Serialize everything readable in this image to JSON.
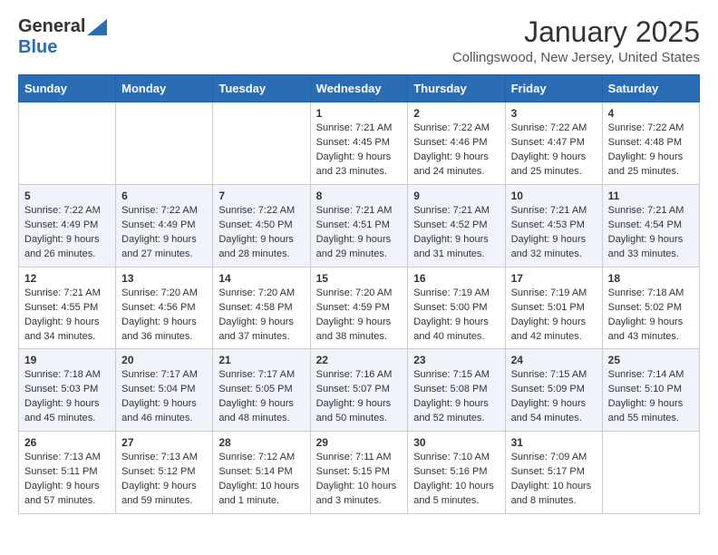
{
  "logo": {
    "general": "General",
    "blue": "Blue"
  },
  "header": {
    "month": "January 2025",
    "location": "Collingswood, New Jersey, United States"
  },
  "weekdays": [
    "Sunday",
    "Monday",
    "Tuesday",
    "Wednesday",
    "Thursday",
    "Friday",
    "Saturday"
  ],
  "weeks": [
    [
      {
        "day": "",
        "info": ""
      },
      {
        "day": "",
        "info": ""
      },
      {
        "day": "",
        "info": ""
      },
      {
        "day": "1",
        "info": "Sunrise: 7:21 AM\nSunset: 4:45 PM\nDaylight: 9 hours\nand 23 minutes."
      },
      {
        "day": "2",
        "info": "Sunrise: 7:22 AM\nSunset: 4:46 PM\nDaylight: 9 hours\nand 24 minutes."
      },
      {
        "day": "3",
        "info": "Sunrise: 7:22 AM\nSunset: 4:47 PM\nDaylight: 9 hours\nand 25 minutes."
      },
      {
        "day": "4",
        "info": "Sunrise: 7:22 AM\nSunset: 4:48 PM\nDaylight: 9 hours\nand 25 minutes."
      }
    ],
    [
      {
        "day": "5",
        "info": "Sunrise: 7:22 AM\nSunset: 4:49 PM\nDaylight: 9 hours\nand 26 minutes."
      },
      {
        "day": "6",
        "info": "Sunrise: 7:22 AM\nSunset: 4:49 PM\nDaylight: 9 hours\nand 27 minutes."
      },
      {
        "day": "7",
        "info": "Sunrise: 7:22 AM\nSunset: 4:50 PM\nDaylight: 9 hours\nand 28 minutes."
      },
      {
        "day": "8",
        "info": "Sunrise: 7:21 AM\nSunset: 4:51 PM\nDaylight: 9 hours\nand 29 minutes."
      },
      {
        "day": "9",
        "info": "Sunrise: 7:21 AM\nSunset: 4:52 PM\nDaylight: 9 hours\nand 31 minutes."
      },
      {
        "day": "10",
        "info": "Sunrise: 7:21 AM\nSunset: 4:53 PM\nDaylight: 9 hours\nand 32 minutes."
      },
      {
        "day": "11",
        "info": "Sunrise: 7:21 AM\nSunset: 4:54 PM\nDaylight: 9 hours\nand 33 minutes."
      }
    ],
    [
      {
        "day": "12",
        "info": "Sunrise: 7:21 AM\nSunset: 4:55 PM\nDaylight: 9 hours\nand 34 minutes."
      },
      {
        "day": "13",
        "info": "Sunrise: 7:20 AM\nSunset: 4:56 PM\nDaylight: 9 hours\nand 36 minutes."
      },
      {
        "day": "14",
        "info": "Sunrise: 7:20 AM\nSunset: 4:58 PM\nDaylight: 9 hours\nand 37 minutes."
      },
      {
        "day": "15",
        "info": "Sunrise: 7:20 AM\nSunset: 4:59 PM\nDaylight: 9 hours\nand 38 minutes."
      },
      {
        "day": "16",
        "info": "Sunrise: 7:19 AM\nSunset: 5:00 PM\nDaylight: 9 hours\nand 40 minutes."
      },
      {
        "day": "17",
        "info": "Sunrise: 7:19 AM\nSunset: 5:01 PM\nDaylight: 9 hours\nand 42 minutes."
      },
      {
        "day": "18",
        "info": "Sunrise: 7:18 AM\nSunset: 5:02 PM\nDaylight: 9 hours\nand 43 minutes."
      }
    ],
    [
      {
        "day": "19",
        "info": "Sunrise: 7:18 AM\nSunset: 5:03 PM\nDaylight: 9 hours\nand 45 minutes."
      },
      {
        "day": "20",
        "info": "Sunrise: 7:17 AM\nSunset: 5:04 PM\nDaylight: 9 hours\nand 46 minutes."
      },
      {
        "day": "21",
        "info": "Sunrise: 7:17 AM\nSunset: 5:05 PM\nDaylight: 9 hours\nand 48 minutes."
      },
      {
        "day": "22",
        "info": "Sunrise: 7:16 AM\nSunset: 5:07 PM\nDaylight: 9 hours\nand 50 minutes."
      },
      {
        "day": "23",
        "info": "Sunrise: 7:15 AM\nSunset: 5:08 PM\nDaylight: 9 hours\nand 52 minutes."
      },
      {
        "day": "24",
        "info": "Sunrise: 7:15 AM\nSunset: 5:09 PM\nDaylight: 9 hours\nand 54 minutes."
      },
      {
        "day": "25",
        "info": "Sunrise: 7:14 AM\nSunset: 5:10 PM\nDaylight: 9 hours\nand 55 minutes."
      }
    ],
    [
      {
        "day": "26",
        "info": "Sunrise: 7:13 AM\nSunset: 5:11 PM\nDaylight: 9 hours\nand 57 minutes."
      },
      {
        "day": "27",
        "info": "Sunrise: 7:13 AM\nSunset: 5:12 PM\nDaylight: 9 hours\nand 59 minutes."
      },
      {
        "day": "28",
        "info": "Sunrise: 7:12 AM\nSunset: 5:14 PM\nDaylight: 10 hours\nand 1 minute."
      },
      {
        "day": "29",
        "info": "Sunrise: 7:11 AM\nSunset: 5:15 PM\nDaylight: 10 hours\nand 3 minutes."
      },
      {
        "day": "30",
        "info": "Sunrise: 7:10 AM\nSunset: 5:16 PM\nDaylight: 10 hours\nand 5 minutes."
      },
      {
        "day": "31",
        "info": "Sunrise: 7:09 AM\nSunset: 5:17 PM\nDaylight: 10 hours\nand 8 minutes."
      },
      {
        "day": "",
        "info": ""
      }
    ]
  ]
}
